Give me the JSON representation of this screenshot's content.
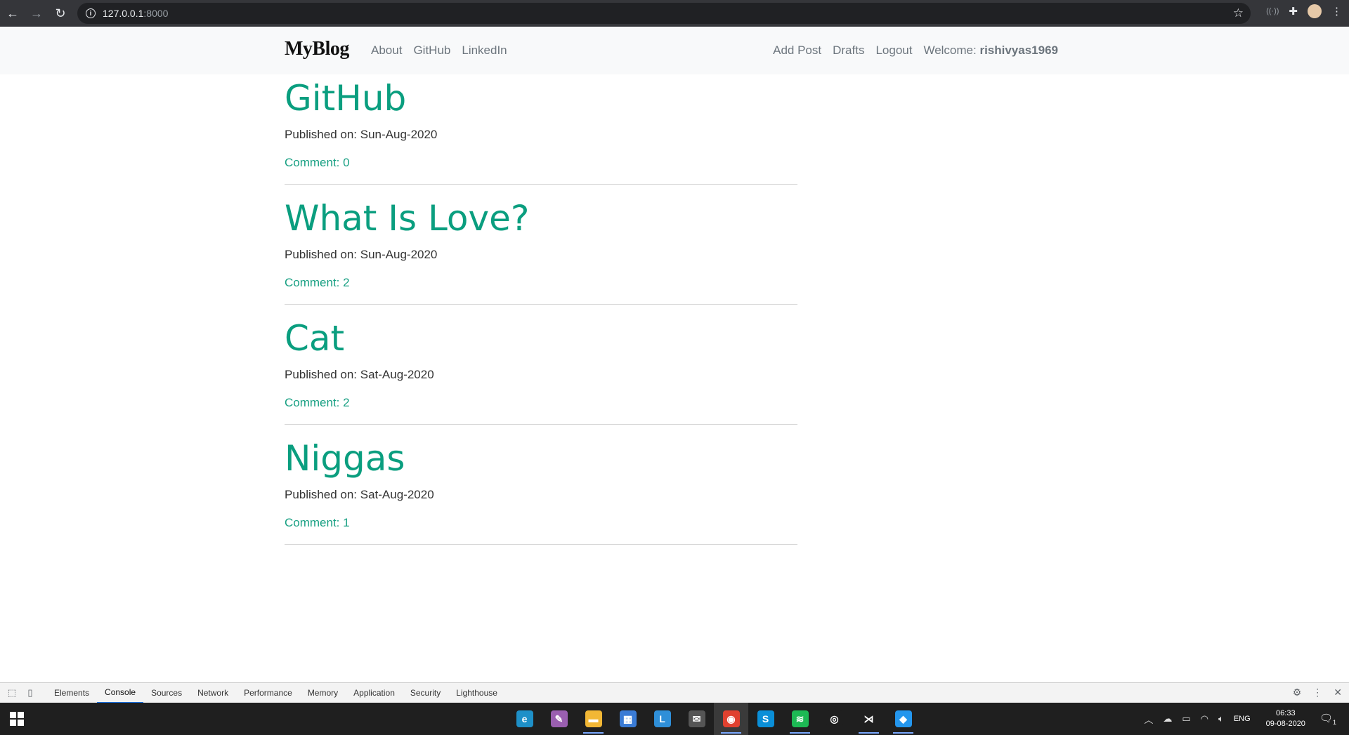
{
  "browser": {
    "url_host": "127.0.0.1",
    "url_port": ":8000"
  },
  "site": {
    "brand": "MyBlog",
    "nav_left": [
      "About",
      "GitHub",
      "LinkedIn"
    ],
    "nav_right": [
      "Add Post",
      "Drafts",
      "Logout"
    ],
    "welcome_label": "Welcome:",
    "username": "rishivyas1969",
    "accent_color": "#0a9e7f"
  },
  "posts": [
    {
      "title": "GitHub",
      "date": "Published on: Sun-Aug-2020",
      "comments": "Comment: 0"
    },
    {
      "title": "What Is Love?",
      "date": "Published on: Sun-Aug-2020",
      "comments": "Comment: 2"
    },
    {
      "title": "Cat",
      "date": "Published on: Sat-Aug-2020",
      "comments": "Comment: 2"
    },
    {
      "title": "Niggas",
      "date": "Published on: Sat-Aug-2020",
      "comments": "Comment: 1"
    }
  ],
  "devtools": {
    "tabs": [
      "Elements",
      "Console",
      "Sources",
      "Network",
      "Performance",
      "Memory",
      "Application",
      "Security",
      "Lighthouse"
    ],
    "active_tab": "Console"
  },
  "taskbar": {
    "apps": [
      {
        "name": "edge-icon",
        "color": "#1e90c8",
        "glyph": "e"
      },
      {
        "name": "paint-icon",
        "color": "#9a5fb0",
        "glyph": "✎"
      },
      {
        "name": "file-explorer-icon",
        "color": "#f2b735",
        "glyph": "▬"
      },
      {
        "name": "store-icon",
        "color": "#3a7bd5",
        "glyph": "▦"
      },
      {
        "name": "l-app-icon",
        "color": "#2f8fd8",
        "glyph": "L"
      },
      {
        "name": "mail-icon",
        "color": "#555555",
        "glyph": "✉"
      },
      {
        "name": "chrome-icon",
        "color": "#e0412f",
        "glyph": "◉"
      },
      {
        "name": "skype-icon",
        "color": "#0a8fd8",
        "glyph": "S"
      },
      {
        "name": "spotify-icon",
        "color": "#1db954",
        "glyph": "≋"
      },
      {
        "name": "circle-app-icon",
        "color": "#1f1f1f",
        "glyph": "◎"
      },
      {
        "name": "vscode-icon",
        "color": "#1f1f1f",
        "glyph": "⋊"
      },
      {
        "name": "docker-icon",
        "color": "#2496ed",
        "glyph": "◆"
      }
    ],
    "language": "ENG",
    "time": "06:33",
    "date": "09-08-2020",
    "notification_count": "1"
  }
}
